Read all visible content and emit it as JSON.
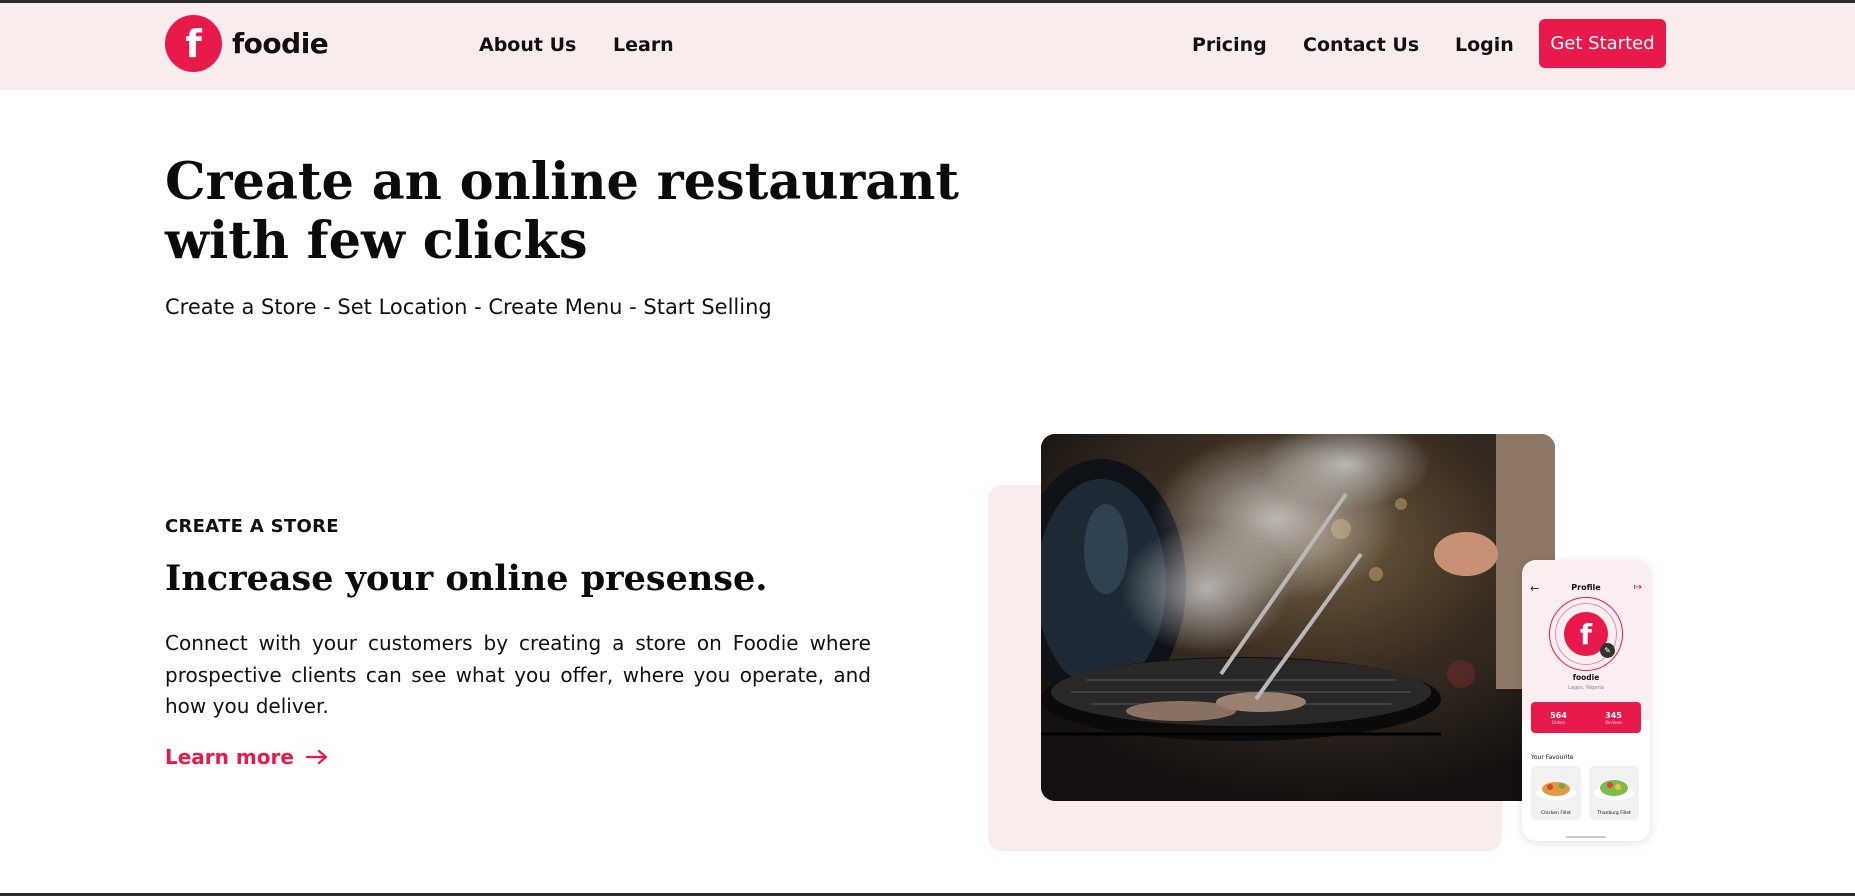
{
  "brand": {
    "name": "foodie",
    "logo_letter": "f",
    "accent_color": "#e8194b",
    "header_bg": "#f9eced"
  },
  "nav": {
    "about": "About Us",
    "learn": "Learn",
    "pricing": "Pricing",
    "contact": "Contact Us",
    "login": "Login",
    "cta": "Get Started"
  },
  "hero": {
    "title": "Create an online restaurant with few clicks",
    "subtitle": "Create a Store - Set Location - Create Menu - Start Selling"
  },
  "feature": {
    "eyebrow": "CREATE A STORE",
    "title": "Increase your online presense.",
    "description": "Connect with your customers by creating a store on Foodie where prospective clients can see what you offer, where you operate, and how you deliver.",
    "link_label": "Learn more",
    "link_icon": "arrow-right-icon"
  },
  "phone": {
    "back_icon": "←",
    "title": "Profile",
    "logout_icon": "↦",
    "logo_letter": "f",
    "edit_icon": "✎",
    "name": "foodie",
    "location": "Lagos, Nigeria",
    "stats": [
      {
        "value": "564",
        "label": "Orders"
      },
      {
        "value": "345",
        "label": "Reviews"
      }
    ],
    "favourites_label": "Your Favourite",
    "favourites": [
      {
        "label": "Chicken Fillet"
      },
      {
        "label": "Thanburg Fillet"
      }
    ]
  }
}
